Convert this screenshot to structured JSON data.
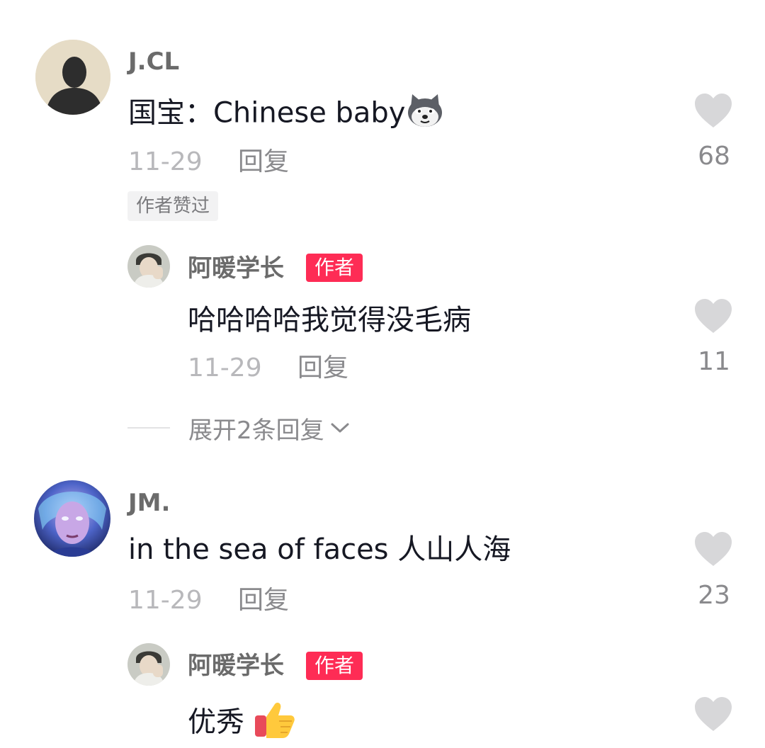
{
  "comments": [
    {
      "username": "J.CL",
      "text": "国宝：Chinese baby",
      "date": "11-29",
      "reply_label": "回复",
      "likes": "68",
      "liked_by_author_label": "作者赞过",
      "reply": {
        "username": "阿暖学长",
        "badge": "作者",
        "text": "哈哈哈哈我觉得没毛病",
        "date": "11-29",
        "reply_label": "回复",
        "likes": "11"
      },
      "expand_label": "展开2条回复"
    },
    {
      "username": "JM.",
      "text": "in the sea of faces 人山人海",
      "date": "11-29",
      "reply_label": "回复",
      "likes": "23",
      "reply": {
        "username": "阿暖学长",
        "badge": "作者",
        "text": "优秀"
      }
    }
  ],
  "colors": {
    "author_badge": "#fe2c55",
    "like_icon": "#d7d7d9",
    "meta_gray": "#8a8a8d"
  },
  "icons": [
    "heart-icon",
    "chevron-down-icon",
    "husky-emoji-icon",
    "thumbs-up-emoji-icon"
  ]
}
